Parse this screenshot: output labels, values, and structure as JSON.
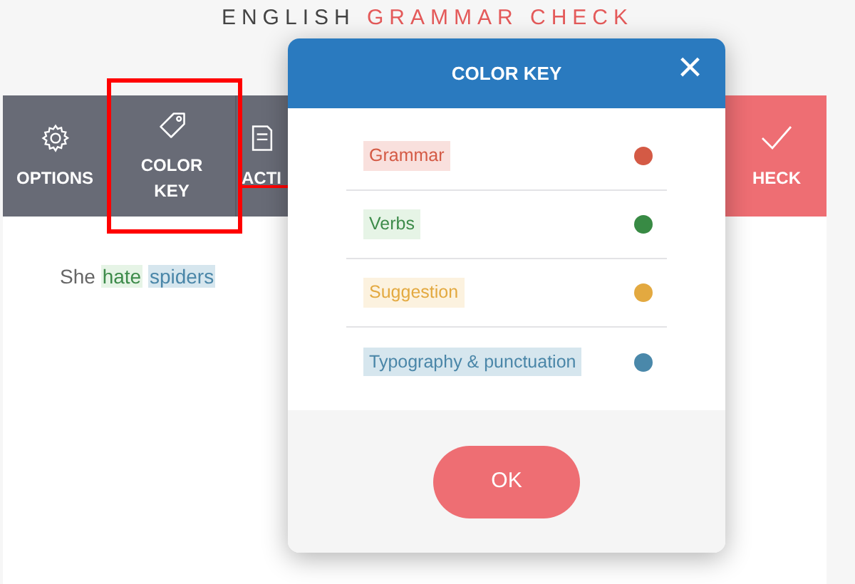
{
  "page": {
    "title_part_1": "ENGLISH",
    "title_part_2": "GRAMMAR CHECK"
  },
  "toolbar": [
    {
      "label": "OPTIONS"
    },
    {
      "label": "COLOR KEY"
    },
    {
      "label": "ACTI"
    }
  ],
  "check_button": {
    "label": "HECK"
  },
  "text": [
    {
      "text": "She",
      "kind": "plain"
    },
    {
      "text": "hate",
      "kind": "verbs"
    },
    {
      "text": "spiders",
      "kind": "typography"
    }
  ],
  "dialog": {
    "title": "COLOR KEY",
    "close": "×",
    "items": [
      {
        "label": "Grammar",
        "kind": "grammar",
        "color": "#d45a45"
      },
      {
        "label": "Verbs",
        "kind": "verbs",
        "color": "#388a44"
      },
      {
        "label": "Suggestion",
        "kind": "suggestion",
        "color": "#e3a940"
      },
      {
        "label": "Typography & punctuation",
        "kind": "typography",
        "color": "#4a88aa"
      }
    ],
    "ok": "OK"
  }
}
